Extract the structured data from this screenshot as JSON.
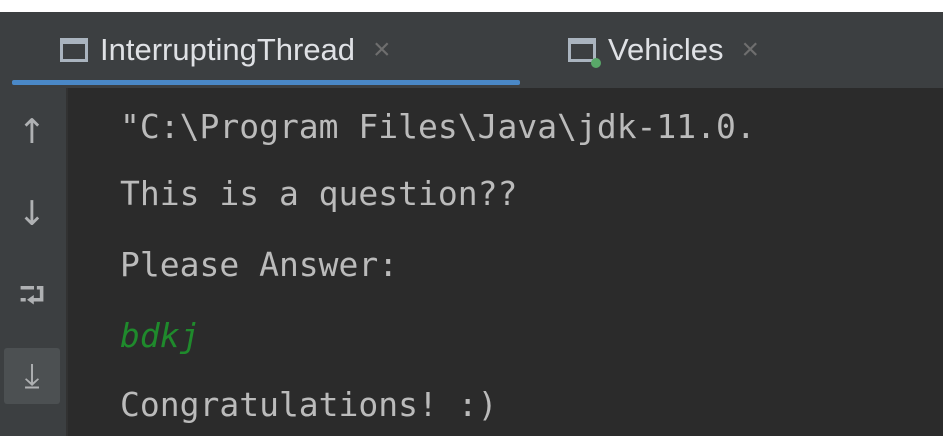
{
  "tabs": [
    {
      "label": "InterruptingThread",
      "active": true,
      "close": "×",
      "icon": "window-icon"
    },
    {
      "label": "Vehicles",
      "active": false,
      "close": "×",
      "icon": "window-run-icon"
    }
  ],
  "gutter": {
    "up": "↑",
    "down": "↓",
    "wrap": "⮒",
    "scroll_end": "⤓"
  },
  "console": {
    "lines": [
      "\"C:\\Program Files\\Java\\jdk-11.0.",
      "This is a question??",
      "Please Answer:",
      "bdkj",
      "Congratulations! :)"
    ]
  },
  "colors": {
    "background": "#2b2b2b",
    "panel": "#3c3f41",
    "text": "#bbbbbb",
    "user_input": "#1f8a2c",
    "tab_accent": "#4a88c7"
  }
}
